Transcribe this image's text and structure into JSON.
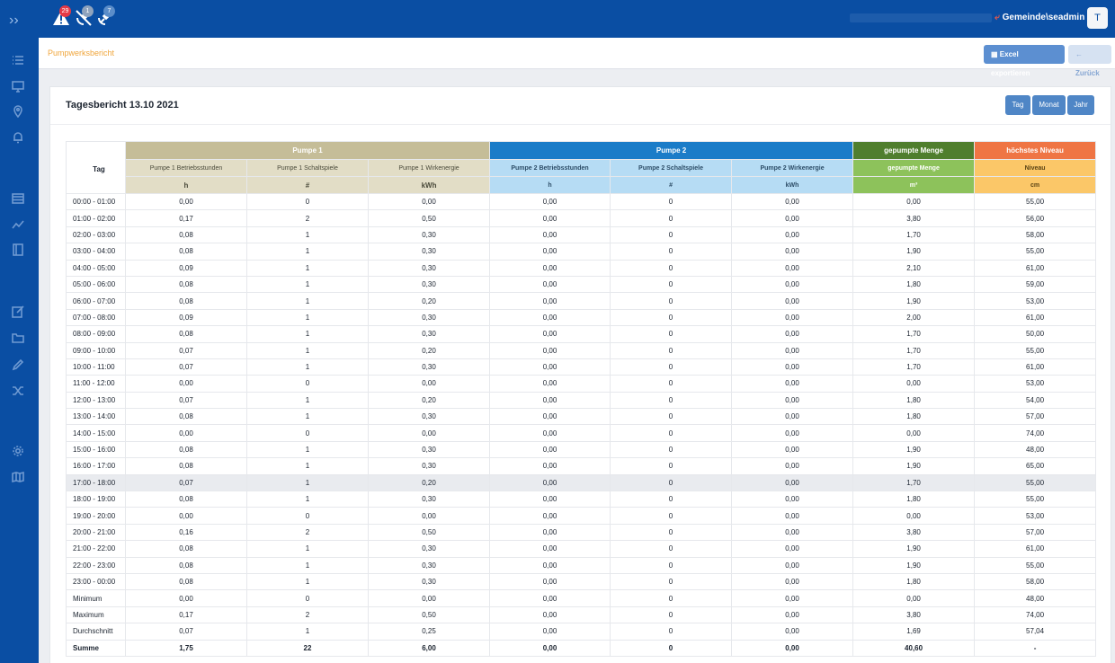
{
  "topbar": {
    "alerts": [
      {
        "icon": "warning-icon",
        "count": "29",
        "color": "#e53946"
      },
      {
        "icon": "satellite-off-icon",
        "count": "1",
        "color": "#8fa3bd"
      },
      {
        "icon": "satellite-icon",
        "count": "7",
        "color": "#5b8dc9"
      }
    ],
    "user": "Gemeinde\\seadmin",
    "avatar_letter": "T"
  },
  "sidebar": {
    "icons": [
      "list-icon",
      "monitor-icon",
      "location-pin-icon",
      "bell-icon",
      "table-icon",
      "trend-chart-icon",
      "book-icon",
      "edit-document-icon",
      "folder-icon",
      "pencil-icon",
      "shuffle-icon",
      "settings-icon",
      "map-icon"
    ]
  },
  "breadcrumb": {
    "label": "Pumpwerksbericht"
  },
  "actions": {
    "export": "Excel exportieren",
    "back": "Zurück"
  },
  "report": {
    "title": "Tagesbericht 13.10 2021",
    "periods": [
      "Tag",
      "Monat",
      "Jahr"
    ],
    "row_header": "Tag",
    "groups": [
      {
        "label": "Pumpe 1",
        "color": "#c5bd98"
      },
      {
        "label": "Pumpe 2",
        "color": "#1b7cc8"
      },
      {
        "label": "gepumpte Menge",
        "color": "#4f7e2e"
      },
      {
        "label": "höchstes Niveau",
        "color": "#ef7544"
      }
    ],
    "columns": [
      {
        "name": "Pumpe 1 Betriebsstunden",
        "unit": "h"
      },
      {
        "name": "Pumpe 1 Schaltspiele",
        "unit": "#"
      },
      {
        "name": "Pumpe 1 Wirkenergie",
        "unit": "kWh"
      },
      {
        "name": "Pumpe 2 Betriebsstunden",
        "unit": "h"
      },
      {
        "name": "Pumpe 2 Schaltspiele",
        "unit": "#"
      },
      {
        "name": "Pumpe 2 Wirkenergie",
        "unit": "kWh"
      },
      {
        "name": "gepumpte Menge",
        "unit": "m³"
      },
      {
        "name": "Niveau",
        "unit": "cm"
      }
    ],
    "rows": [
      [
        "00:00 - 01:00",
        "0,00",
        "0",
        "0,00",
        "0,00",
        "0",
        "0,00",
        "0,00",
        "55,00"
      ],
      [
        "01:00 - 02:00",
        "0,17",
        "2",
        "0,50",
        "0,00",
        "0",
        "0,00",
        "3,80",
        "56,00"
      ],
      [
        "02:00 - 03:00",
        "0,08",
        "1",
        "0,30",
        "0,00",
        "0",
        "0,00",
        "1,70",
        "58,00"
      ],
      [
        "03:00 - 04:00",
        "0,08",
        "1",
        "0,30",
        "0,00",
        "0",
        "0,00",
        "1,90",
        "55,00"
      ],
      [
        "04:00 - 05:00",
        "0,09",
        "1",
        "0,30",
        "0,00",
        "0",
        "0,00",
        "2,10",
        "61,00"
      ],
      [
        "05:00 - 06:00",
        "0,08",
        "1",
        "0,30",
        "0,00",
        "0",
        "0,00",
        "1,80",
        "59,00"
      ],
      [
        "06:00 - 07:00",
        "0,08",
        "1",
        "0,20",
        "0,00",
        "0",
        "0,00",
        "1,90",
        "53,00"
      ],
      [
        "07:00 - 08:00",
        "0,09",
        "1",
        "0,30",
        "0,00",
        "0",
        "0,00",
        "2,00",
        "61,00"
      ],
      [
        "08:00 - 09:00",
        "0,08",
        "1",
        "0,30",
        "0,00",
        "0",
        "0,00",
        "1,70",
        "50,00"
      ],
      [
        "09:00 - 10:00",
        "0,07",
        "1",
        "0,20",
        "0,00",
        "0",
        "0,00",
        "1,70",
        "55,00"
      ],
      [
        "10:00 - 11:00",
        "0,07",
        "1",
        "0,30",
        "0,00",
        "0",
        "0,00",
        "1,70",
        "61,00"
      ],
      [
        "11:00 - 12:00",
        "0,00",
        "0",
        "0,00",
        "0,00",
        "0",
        "0,00",
        "0,00",
        "53,00"
      ],
      [
        "12:00 - 13:00",
        "0,07",
        "1",
        "0,20",
        "0,00",
        "0",
        "0,00",
        "1,80",
        "54,00"
      ],
      [
        "13:00 - 14:00",
        "0,08",
        "1",
        "0,30",
        "0,00",
        "0",
        "0,00",
        "1,80",
        "57,00"
      ],
      [
        "14:00 - 15:00",
        "0,00",
        "0",
        "0,00",
        "0,00",
        "0",
        "0,00",
        "0,00",
        "74,00"
      ],
      [
        "15:00 - 16:00",
        "0,08",
        "1",
        "0,30",
        "0,00",
        "0",
        "0,00",
        "1,90",
        "48,00"
      ],
      [
        "16:00 - 17:00",
        "0,08",
        "1",
        "0,30",
        "0,00",
        "0",
        "0,00",
        "1,90",
        "65,00"
      ],
      [
        "17:00 - 18:00",
        "0,07",
        "1",
        "0,20",
        "0,00",
        "0",
        "0,00",
        "1,70",
        "55,00"
      ],
      [
        "18:00 - 19:00",
        "0,08",
        "1",
        "0,30",
        "0,00",
        "0",
        "0,00",
        "1,80",
        "55,00"
      ],
      [
        "19:00 - 20:00",
        "0,00",
        "0",
        "0,00",
        "0,00",
        "0",
        "0,00",
        "0,00",
        "53,00"
      ],
      [
        "20:00 - 21:00",
        "0,16",
        "2",
        "0,50",
        "0,00",
        "0",
        "0,00",
        "3,80",
        "57,00"
      ],
      [
        "21:00 - 22:00",
        "0,08",
        "1",
        "0,30",
        "0,00",
        "0",
        "0,00",
        "1,90",
        "61,00"
      ],
      [
        "22:00 - 23:00",
        "0,08",
        "1",
        "0,30",
        "0,00",
        "0",
        "0,00",
        "1,90",
        "55,00"
      ],
      [
        "23:00 - 00:00",
        "0,08",
        "1",
        "0,30",
        "0,00",
        "0",
        "0,00",
        "1,80",
        "58,00"
      ]
    ],
    "highlight_row": "17:00 - 18:00",
    "stats": [
      [
        "Minimum",
        "0,00",
        "0",
        "0,00",
        "0,00",
        "0",
        "0,00",
        "0,00",
        "48,00"
      ],
      [
        "Maximum",
        "0,17",
        "2",
        "0,50",
        "0,00",
        "0",
        "0,00",
        "3,80",
        "74,00"
      ],
      [
        "Durchschnitt",
        "0,07",
        "1",
        "0,25",
        "0,00",
        "0",
        "0,00",
        "1,69",
        "57,04"
      ]
    ],
    "sum": [
      "Summe",
      "1,75",
      "22",
      "6,00",
      "0,00",
      "0",
      "0,00",
      "40,60",
      "-"
    ]
  }
}
